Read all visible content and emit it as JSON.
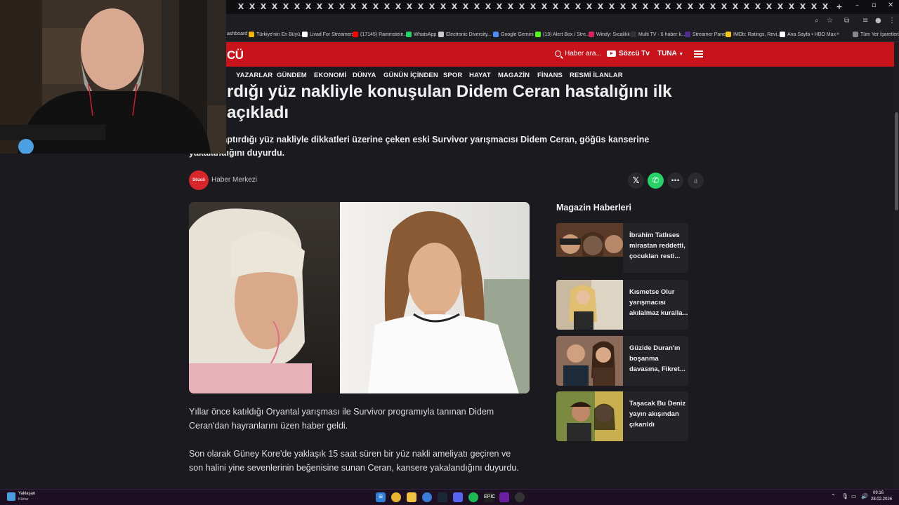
{
  "browser": {
    "tab_close_glyph": "X",
    "tab_count": 53,
    "new_tab_glyph": "+",
    "window_controls": [
      "–",
      "▫",
      "✕"
    ]
  },
  "bookmarks": [
    {
      "label": "ashboard",
      "color": "#888888"
    },
    {
      "label": "Türkiye'nin En Büyü...",
      "color": "#f2b705"
    },
    {
      "label": "Livad For Streamers",
      "color": "#ffffff"
    },
    {
      "label": "(17145) Rammstein...",
      "color": "#ff0000"
    },
    {
      "label": "WhatsApp",
      "color": "#25d366"
    },
    {
      "label": "Electronic Diversity...",
      "color": "#cccccc"
    },
    {
      "label": "Google Gemini",
      "color": "#4c8bf5"
    },
    {
      "label": "(19) Alert Box / Stre...",
      "color": "#53fc18"
    },
    {
      "label": "Windy: Sıcaklık",
      "color": "#d6245c"
    },
    {
      "label": "Multi TV - 6 haber k...",
      "color": "#333333"
    },
    {
      "label": "Streamer Panel",
      "color": "#4b2c8f"
    },
    {
      "label": "IMDb: Ratings, Revi...",
      "color": "#f5c518"
    },
    {
      "label": "Ana Sayfa • HBO Max",
      "color": "#ffffff"
    },
    {
      "label": "Tüm Yer İşaretleri",
      "color": "#888888"
    }
  ],
  "site": {
    "logo": "CÜ",
    "search_label": "Haber ara...",
    "tv_label": "Sözcü Tv",
    "user_label": "TUNA",
    "nav": [
      "YAZARLAR",
      "GÜNDEM",
      "EKONOMİ",
      "DÜNYA",
      "GÜNÜN İÇİNDEN",
      "SPOR",
      "HAYAT",
      "MAGAZİN",
      "FİNANS",
      "RESMİ İLANLAR"
    ]
  },
  "article": {
    "headline_line1": "rdığı yüz nakliyle konuşulan Didem Ceran hastalığını ilk",
    "headline_line2": "açıkladı",
    "summary_line1": "ore'de yaptırdığı yüz nakliyle dikkatleri üzerine çeken eski Survivor yarışmacısı Didem Ceran, göğüs kanserine",
    "summary_line2": "yakalandığını duyurdu.",
    "author_badge": "Sözcü",
    "author": "Haber Merkezi",
    "share_buttons": [
      "X",
      "WhatsApp",
      "More",
      "Font"
    ],
    "paragraph1": "Yıllar önce katıldığı Oryantal yarışması ile Survivor programıyla tanınan Didem Ceran'dan hayranlarını üzen haber geldi.",
    "paragraph2": "Son olarak Güney Kore'de yaklaşık 15 saat süren bir yüz nakli ameliyatı geçiren ve son halini yine sevenlerinin beğenisine sunan Ceran, kansere yakalandığını duyurdu."
  },
  "sidebar": {
    "title": "Magazin Haberleri",
    "items": [
      {
        "title": "İbrahim Tatlıses mirastan reddetti, çocukları resti..."
      },
      {
        "title": "Kısmetse Olur yarışmacısı akılalmaz kuralla..."
      },
      {
        "title": "Güzide Duran'ın boşanma davasına, Fikret..."
      },
      {
        "title": "Taşacak Bu Deniz yayın akışından çıkarıldı"
      }
    ]
  },
  "taskbar": {
    "weather_title": "Yaklaşan",
    "weather_sub": "Kârlar",
    "time": "09:16",
    "date": "28.02.2026"
  }
}
